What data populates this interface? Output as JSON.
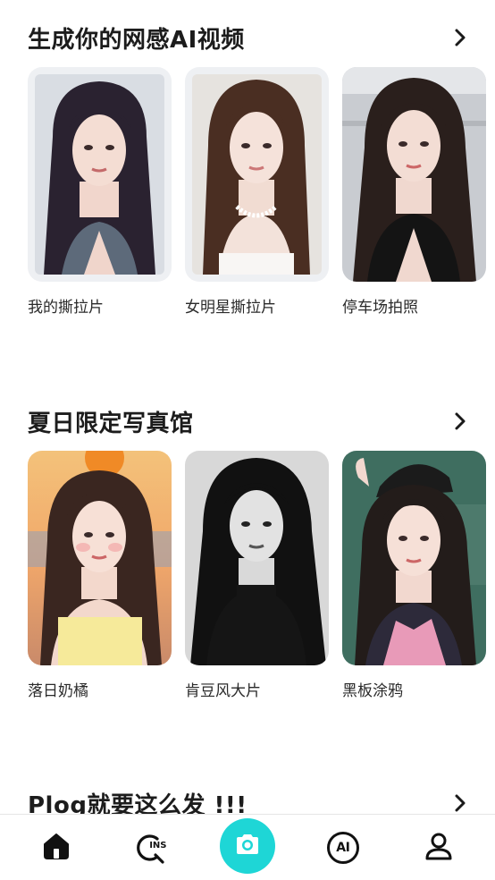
{
  "sections": [
    {
      "title": "生成你的网感AI视频",
      "items": [
        {
          "label": "我的撕拉片"
        },
        {
          "label": "女明星撕拉片"
        },
        {
          "label": "停车场拍照"
        }
      ]
    },
    {
      "title": "夏日限定写真馆",
      "items": [
        {
          "label": "落日奶橘"
        },
        {
          "label": "肯豆风大片"
        },
        {
          "label": "黑板涂鸦"
        }
      ]
    },
    {
      "title": "Plog就要这么发 !!!"
    }
  ],
  "tabbar": {
    "home": "home-icon",
    "ins": "INS",
    "camera": "camera-icon",
    "ai": "AI",
    "profile": "profile-icon",
    "accent": "#1ed6d6"
  }
}
